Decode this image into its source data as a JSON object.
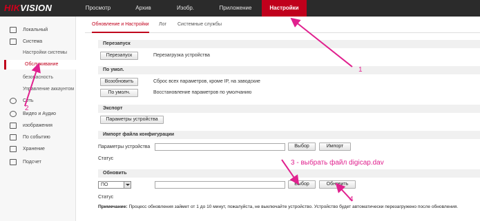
{
  "brand": {
    "logo_text_red": "HIK",
    "logo_text_white": "VISION"
  },
  "topnav": {
    "items": [
      "Просмотр",
      "Архив",
      "Изобр.",
      "Приложение",
      "Настройки"
    ],
    "active": "Настройки"
  },
  "sidebar": {
    "items": [
      {
        "label": "Локальный",
        "icon": "monitor-icon"
      },
      {
        "label": "Система",
        "icon": "system-icon"
      },
      {
        "label": "Сеть",
        "icon": "network-icon"
      },
      {
        "label": "Видео и Аудио",
        "icon": "video-audio-icon"
      },
      {
        "label": "изображения",
        "icon": "image-icon"
      },
      {
        "label": "По событию",
        "icon": "event-icon"
      },
      {
        "label": "Хранение",
        "icon": "storage-icon"
      },
      {
        "label": "Подсчет",
        "icon": "counting-icon"
      }
    ],
    "system_sub": [
      "Настройки системы",
      "Обслуживание",
      "безопасность",
      "Управление аккаунтом"
    ],
    "active_sub": "Обслуживание"
  },
  "tabs": [
    "Обновление и Настройки",
    "Лог",
    "Системные службы"
  ],
  "sections": {
    "reboot": {
      "title": "Перезапуск",
      "button": "Перезапуск",
      "desc": "Перезагрузка устройства"
    },
    "default": {
      "title": "По умол.",
      "restore_button": "Возобновить",
      "restore_desc": "Сброс всех параметров, кроме IP, на заводские",
      "default_button": "По умолч.",
      "default_desc": "Восстановление параметров по умолчанию"
    },
    "export": {
      "title": "Экспорт",
      "button": "Параметры устройства"
    },
    "import": {
      "title": "Импорт файла конфигурации",
      "label": "Параметры устройства",
      "browse": "Выбор",
      "import": "Импорт",
      "status": "Статус"
    },
    "upgrade": {
      "title": "Обновить",
      "select_value": "ПО",
      "browse": "Выбор",
      "upgrade": "Обновить",
      "status": "Статус"
    }
  },
  "note": {
    "bold": "Примечание:",
    "text": " Процесс обновления займет от 1 до 10 минут, пожалуйста, не выключайте устройство. Устройство будет автоматически перезагружено после обновления."
  },
  "annotations": {
    "a1": "1",
    "a2": "2",
    "a3": "3 - выбрать файл digicap.dav",
    "a4": "4",
    "color": "#e0208e"
  },
  "colors": {
    "accent": "#c0001c",
    "topbar": "#2b2b2b"
  }
}
